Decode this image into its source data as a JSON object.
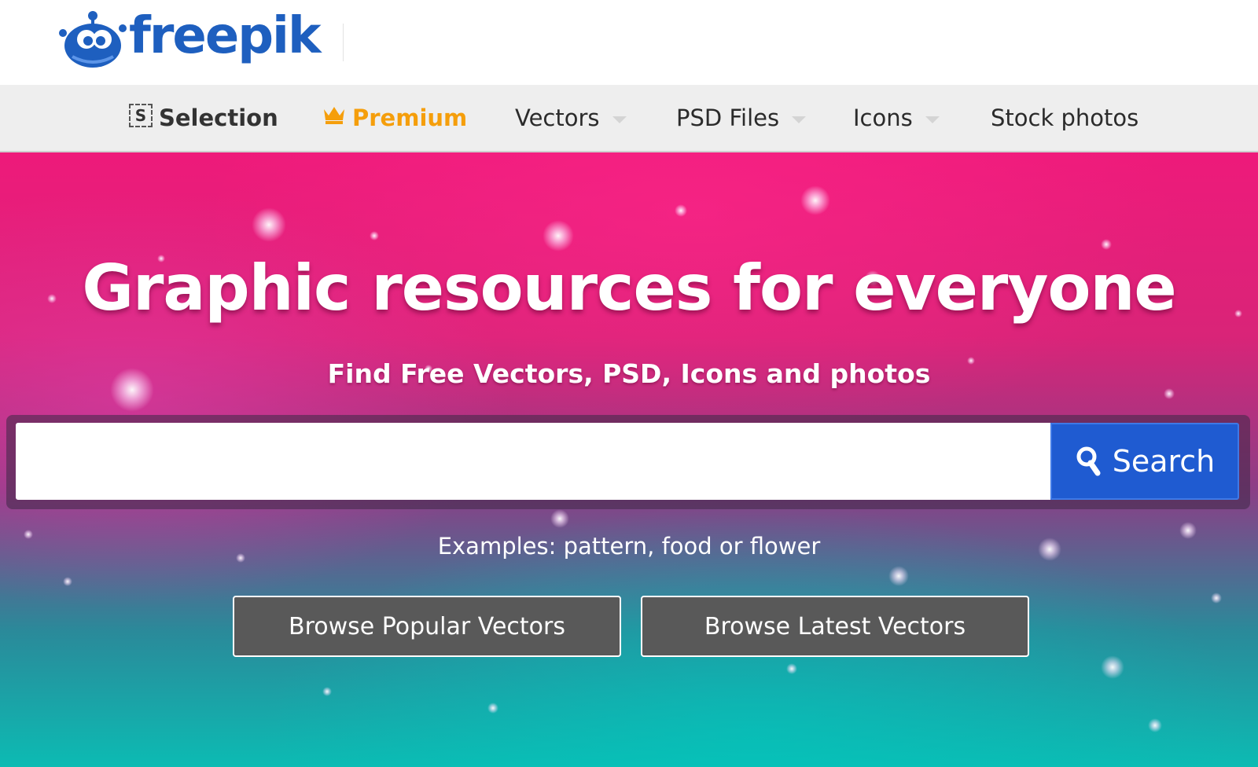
{
  "brand": {
    "name": "freepik",
    "color": "#1e5fbf",
    "logo_icon": "freepik-mascot-icon"
  },
  "nav": {
    "items": [
      {
        "label": "Selection",
        "icon": "selection-icon",
        "icon_glyph": "S"
      },
      {
        "label": "Premium",
        "icon": "crown-icon",
        "color": "#f59e0b"
      },
      {
        "label": "Vectors",
        "has_dropdown": true
      },
      {
        "label": "PSD Files",
        "has_dropdown": true
      },
      {
        "label": "Icons",
        "has_dropdown": true
      },
      {
        "label": "Stock photos",
        "has_dropdown": false
      }
    ]
  },
  "hero": {
    "headline": "Graphic resources for everyone",
    "subheadline": "Find Free Vectors, PSD, Icons and photos",
    "search": {
      "value": "",
      "placeholder": "",
      "button_label": "Search",
      "button_icon": "search-icon",
      "button_color": "#1f5bd1"
    },
    "examples_text": "Examples: pattern, food or flower",
    "browse_popular_label": "Browse Popular Vectors",
    "browse_latest_label": "Browse Latest Vectors"
  }
}
